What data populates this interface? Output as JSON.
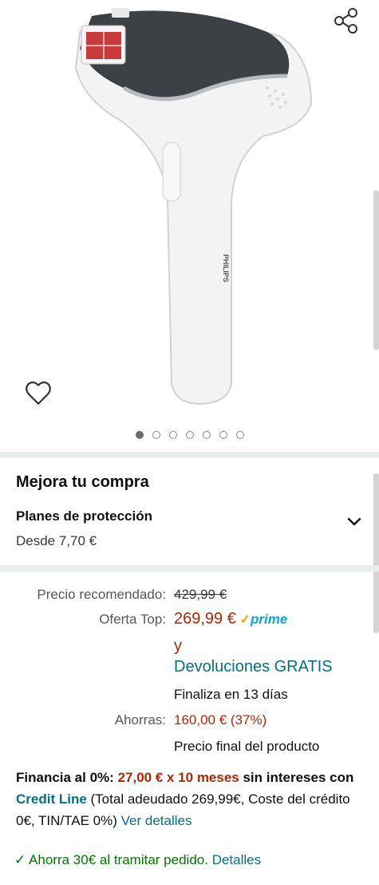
{
  "gallery": {
    "brand_on_device": "PHILIPS",
    "image_count": 7,
    "active_index": 0
  },
  "upgrade": {
    "title": "Mejora tu compra",
    "plan_title": "Planes de protección",
    "plan_price": "Desde 7,70 €"
  },
  "pricing": {
    "rrp_label": "Precio recomendado:",
    "rrp_value": "429,99 €",
    "offer_label": "Oferta Top:",
    "offer_value": "269,99 €",
    "prime_check": "✓",
    "prime_word": "prime",
    "and_word": "y",
    "free_returns": "Devoluciones GRATIS",
    "ends_in": "Finaliza en 13 días",
    "savings_label": "Ahorras:",
    "savings_value": "160,00 € (37%)",
    "final_price_note": "Precio final del producto"
  },
  "finance": {
    "lead": "Financia al 0%:",
    "amount": "27,00 € x 10 meses",
    "mid": " sin intereses con ",
    "provider": "Credit Line",
    "details": " (Total adeudado 269,99€, Coste del crédito 0€, TIN/TAE 0%) ",
    "link": "Ver detalles"
  },
  "promo": {
    "check": "✓",
    "text": "Ahorra 30€ al tramitar pedido.",
    "link": "Detalles"
  },
  "colors": {
    "price_red": "#b12704",
    "link_teal": "#007185",
    "success_green": "#007600",
    "prime_blue": "#00a8e1"
  }
}
